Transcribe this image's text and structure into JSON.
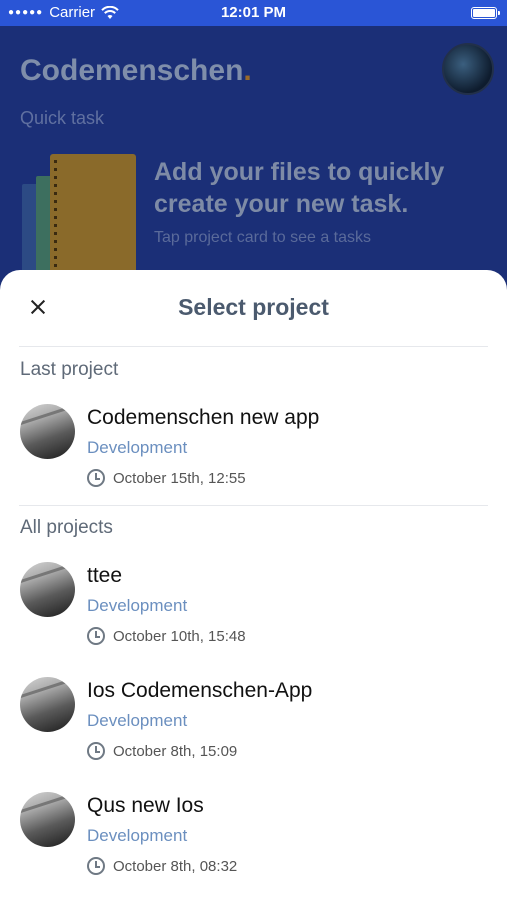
{
  "status_bar": {
    "carrier": "Carrier",
    "time": "12:01 PM"
  },
  "background": {
    "app_title": "Codemenschen",
    "app_title_dot": ".",
    "section": "Quick task",
    "promo_heading": "Add your files to quickly create your new task.",
    "promo_sub": "Tap project card to see a tasks"
  },
  "sheet": {
    "title": "Select project",
    "last_label": "Last project",
    "all_label": "All projects",
    "last_project": {
      "name": "Codemenschen new app",
      "category": "Development",
      "date": "October 15th, 12:55"
    },
    "projects": [
      {
        "name": "ttee",
        "category": "Development",
        "date": "October 10th, 15:48"
      },
      {
        "name": "Ios Codemenschen-App",
        "category": "Development",
        "date": "October 8th, 15:09"
      },
      {
        "name": "Qus new Ios",
        "category": "Development",
        "date": "October 8th, 08:32"
      }
    ]
  },
  "icons": {
    "close": "close-icon",
    "clock": "clock-icon",
    "wifi": "wifi-icon",
    "battery": "battery-icon"
  }
}
